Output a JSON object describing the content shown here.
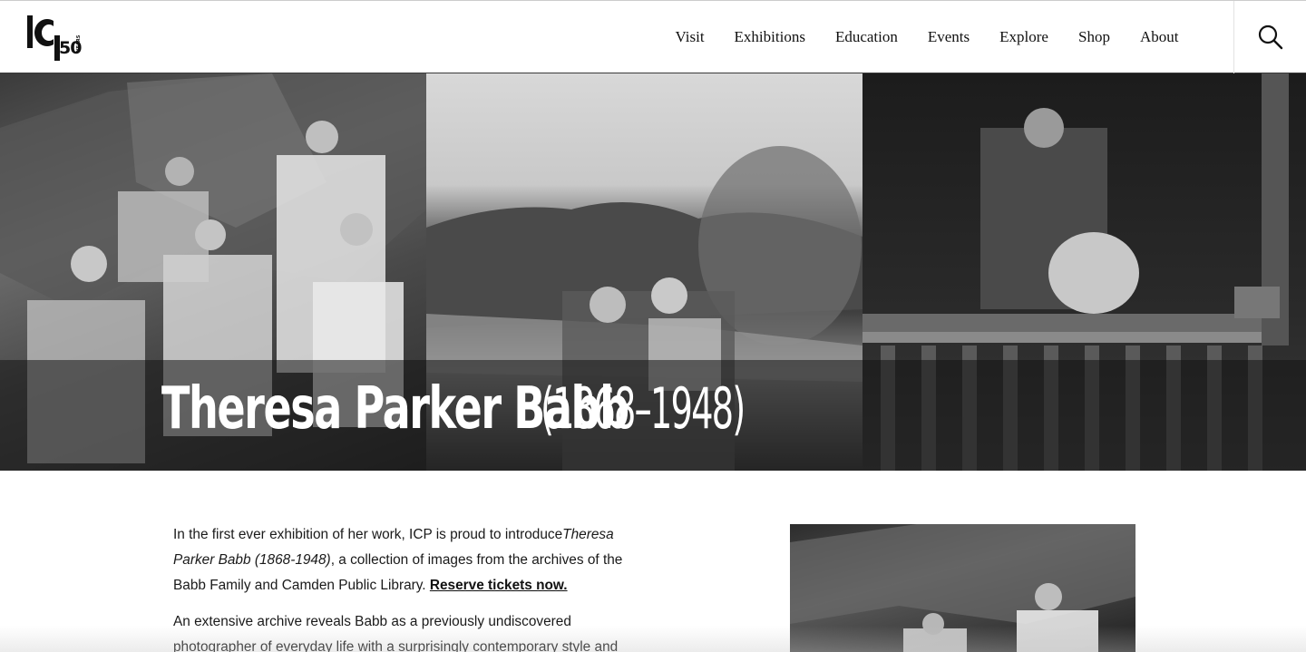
{
  "header": {
    "logo": {
      "letters": "ICP",
      "number": "50",
      "sub": "YEARS"
    },
    "nav": [
      "Visit",
      "Exhibitions",
      "Education",
      "Events",
      "Explore",
      "Shop",
      "About"
    ],
    "search_icon": "search-icon"
  },
  "hero": {
    "name": "Theresa Parker Babb",
    "years": "(1868–1948)"
  },
  "content": {
    "p1_before": "In the first ever exhibition of her work, ICP is proud to introduce",
    "p1_italic": "Theresa Parker Babb (1868-1948)",
    "p1_after": ", a collection of images from the archives of the Babb Family and Camden Public Library.",
    "p1_link": "Reserve tickets now.",
    "p2": "An extensive archive reveals Babb as a previously undiscovered photographer of everyday life with a surprisingly contemporary style and"
  }
}
